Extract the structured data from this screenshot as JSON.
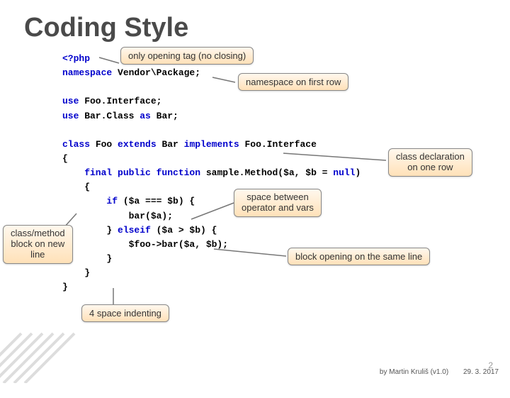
{
  "title": "Coding Style",
  "code": {
    "l1a": "<?php",
    "l2a": "namespace",
    "l2b": " Vendor\\Package;",
    "l3a": "use",
    "l3b": " Foo.Interface;",
    "l4a": "use",
    "l4b": " Bar.Class ",
    "l4c": "as",
    "l4d": " Bar;",
    "l5a": "class",
    "l5b": " Foo ",
    "l5c": "extends",
    "l5d": " Bar ",
    "l5e": "implements",
    "l5f": " Foo.Interface",
    "l6": "{",
    "l7a": "    final public function",
    "l7b": " sample.Method($a, $b = ",
    "l7c": "null",
    "l7d": ")",
    "l8": "    {",
    "l9a": "        if",
    "l9b": " ($a === $b) {",
    "l10": "            bar($a);",
    "l11a": "        } ",
    "l11b": "elseif",
    "l11c": " ($a > $b) {",
    "l12": "            $foo->bar($a, $b);",
    "l13": "        }",
    "l14": "    }",
    "l15": "}"
  },
  "callouts": {
    "openingTag": "only opening tag (no closing)",
    "nsFirst": "namespace on first row",
    "classDecl": "class declaration\non one row",
    "spaceOp": "space between\noperator and vars",
    "blockSame": "block opening on the same line",
    "classMethod": "class/method\nblock on new\nline",
    "indent": "4 space indenting"
  },
  "footer": {
    "author": "by Martin Kruliš (v1.0)",
    "date": "29. 3. 2017",
    "slide": "2"
  }
}
